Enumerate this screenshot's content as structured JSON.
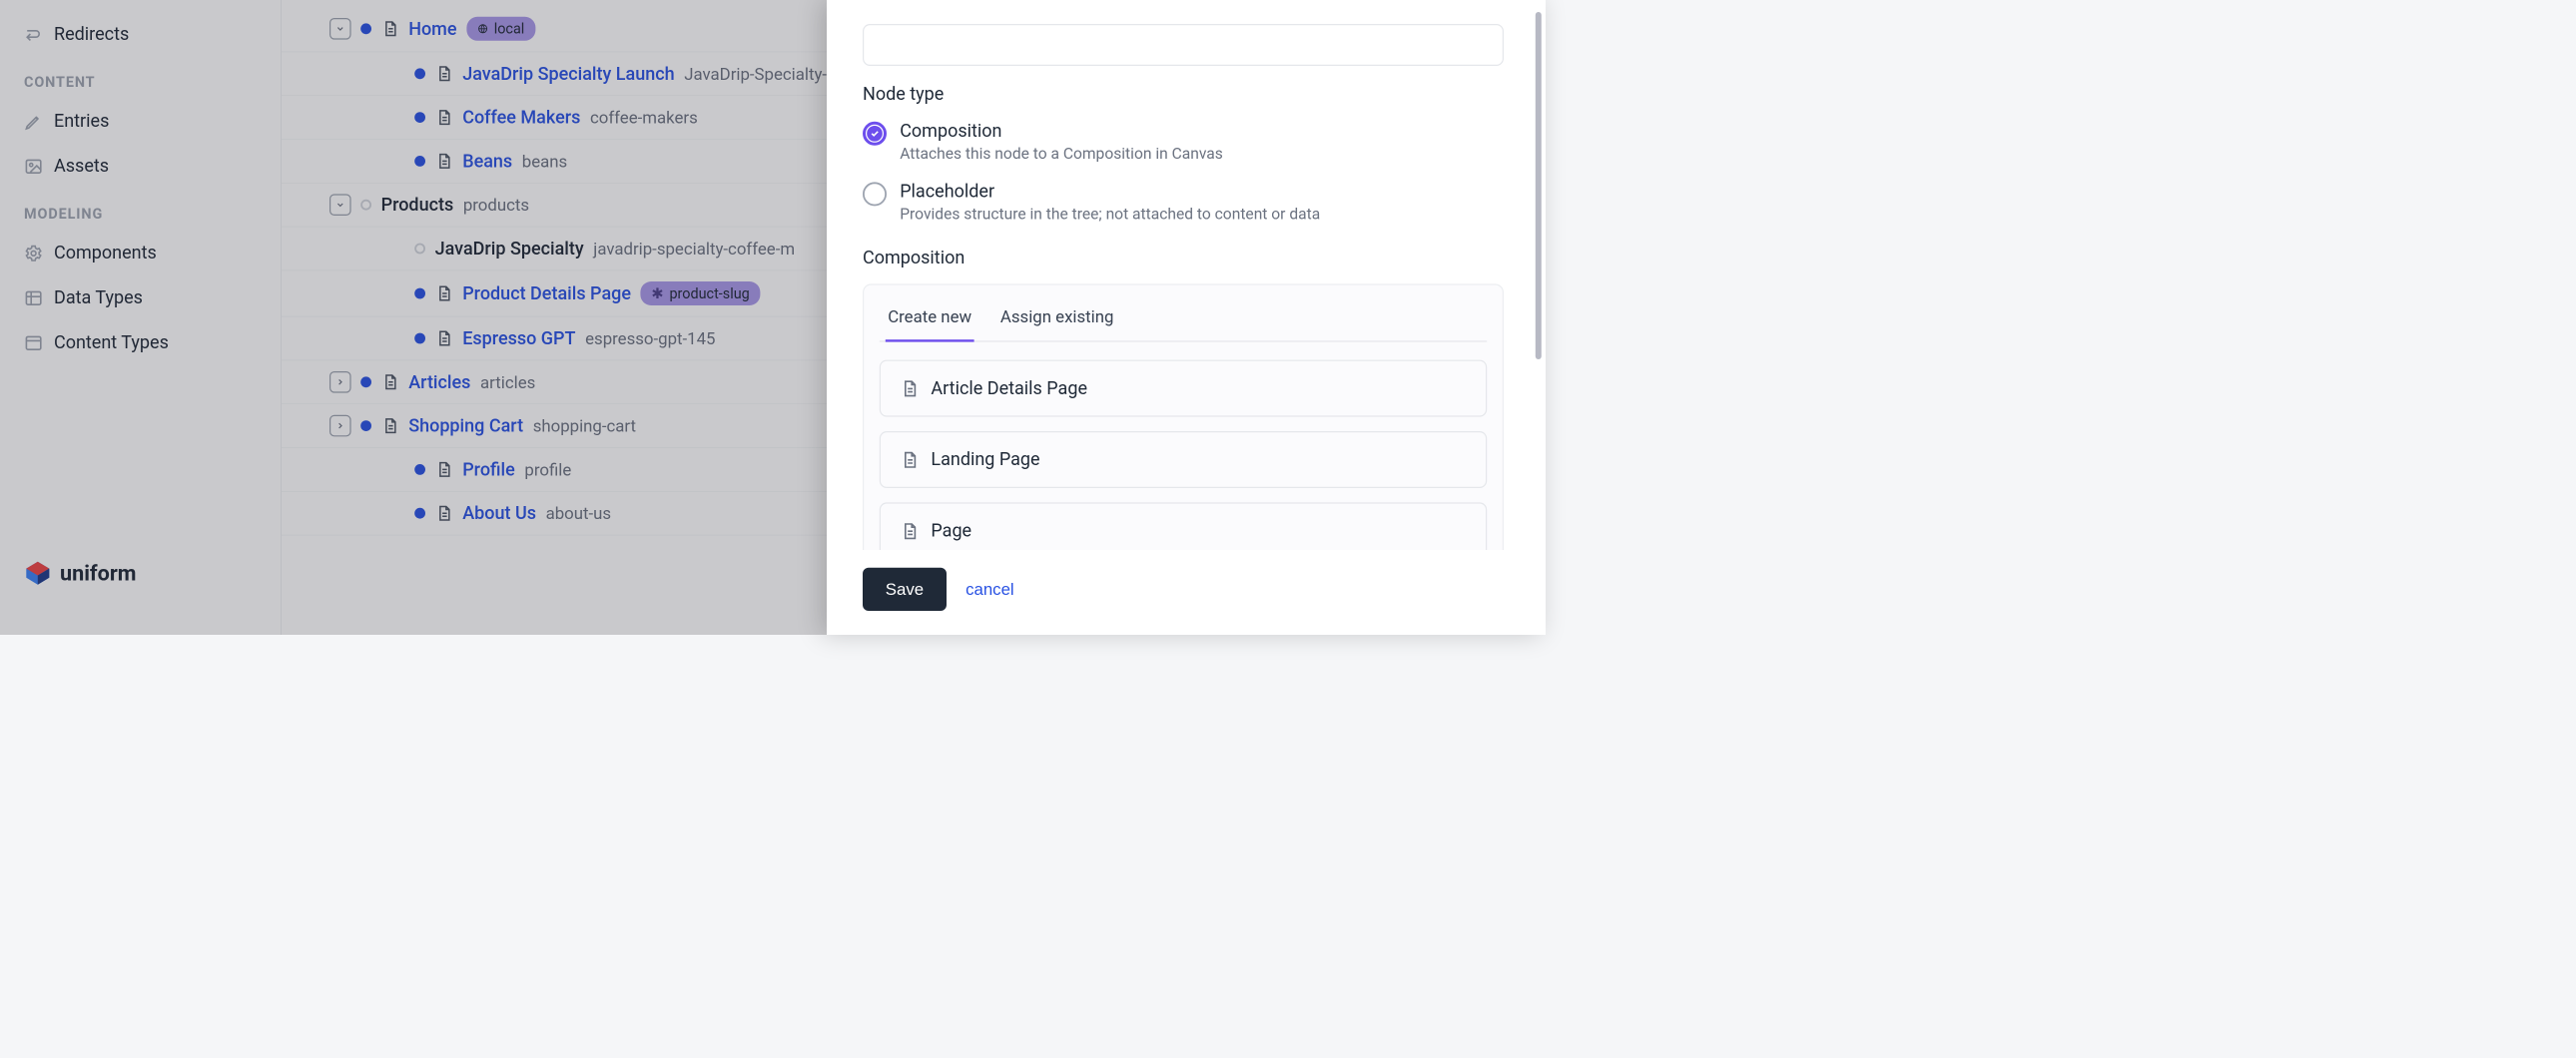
{
  "sidebar": {
    "redirects": "Redirects",
    "section_content": "CONTENT",
    "entries": "Entries",
    "assets": "Assets",
    "section_modeling": "MODELING",
    "components": "Components",
    "data_types": "Data Types",
    "content_types": "Content Types",
    "brand": "uniform"
  },
  "tree": [
    {
      "indent": 1,
      "caret": "down",
      "dot": "blue",
      "icon": true,
      "label": "Home",
      "slug": "",
      "pill": "local",
      "link": true
    },
    {
      "indent": 2,
      "caret": null,
      "dot": "blue",
      "icon": true,
      "label": "JavaDrip Specialty Launch",
      "slug": "JavaDrip-Specialty-",
      "link": true
    },
    {
      "indent": 2,
      "caret": null,
      "dot": "blue",
      "icon": true,
      "label": "Coffee Makers",
      "slug": "coffee-makers",
      "link": true
    },
    {
      "indent": 2,
      "caret": null,
      "dot": "blue",
      "icon": true,
      "label": "Beans",
      "slug": "beans",
      "link": true
    },
    {
      "indent": 1,
      "caret": "down",
      "dot": "empty",
      "icon": false,
      "label": "Products",
      "slug": "products",
      "link": false
    },
    {
      "indent": 2,
      "caret": null,
      "dot": "empty",
      "icon": false,
      "label": "JavaDrip Specialty",
      "slug": "javadrip-specialty-coffee-m",
      "link": false
    },
    {
      "indent": 2,
      "caret": null,
      "dot": "blue",
      "icon": true,
      "label": "Product Details Page",
      "slug": "",
      "pill_star": "product-slug",
      "link": true
    },
    {
      "indent": 2,
      "caret": null,
      "dot": "blue",
      "icon": true,
      "label": "Espresso GPT",
      "slug": "espresso-gpt-145",
      "link": true
    },
    {
      "indent": 1,
      "caret": "right",
      "dot": "blue",
      "icon": true,
      "label": "Articles",
      "slug": "articles",
      "link": true
    },
    {
      "indent": 1,
      "caret": "right",
      "dot": "blue",
      "icon": true,
      "label": "Shopping Cart",
      "slug": "shopping-cart",
      "link": true
    },
    {
      "indent": 2,
      "caret": null,
      "dot": "blue",
      "icon": true,
      "label": "Profile",
      "slug": "profile",
      "link": true
    },
    {
      "indent": 2,
      "caret": null,
      "dot": "blue",
      "icon": true,
      "label": "About Us",
      "slug": "about-us",
      "link": true
    }
  ],
  "panel": {
    "node_type_label": "Node type",
    "radios": {
      "composition": {
        "title": "Composition",
        "desc": "Attaches this node to a Composition in Canvas"
      },
      "placeholder": {
        "title": "Placeholder",
        "desc": "Provides structure in the tree; not attached to content or data"
      }
    },
    "composition_label": "Composition",
    "tabs": {
      "create": "Create new",
      "assign": "Assign existing"
    },
    "options": [
      "Article Details Page",
      "Landing Page",
      "Page"
    ],
    "save": "Save",
    "cancel": "cancel"
  }
}
